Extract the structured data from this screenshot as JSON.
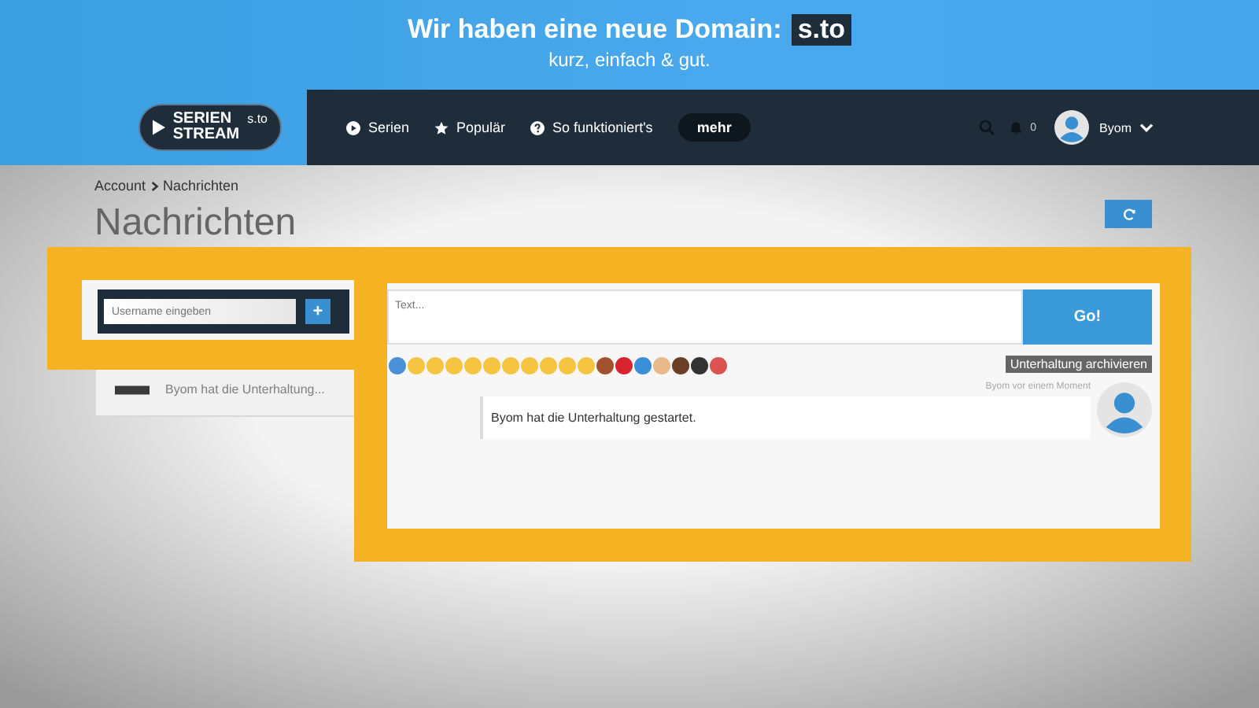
{
  "banner": {
    "headline": "Wir haben eine neue Domain:",
    "domain": "s.to",
    "tagline": "kurz, einfach & gut."
  },
  "logo": {
    "line_1": "SERIEN",
    "line_2": "STREAM",
    "suffix": "s.to"
  },
  "nav": [
    {
      "kind": "play",
      "label": "Serien"
    },
    {
      "kind": "star",
      "label": "Populär"
    },
    {
      "kind": "help",
      "label": "So funktioniert's"
    },
    {
      "kind": "pill",
      "label": "mehr"
    }
  ],
  "user": {
    "notifications": "0",
    "name": "Byom"
  },
  "breadcrumb": [
    "Account",
    "Nachrichten"
  ],
  "heading": "Nachrichten",
  "conversations": [
    {
      "preview": "Byom hat die Unterhaltung..."
    }
  ],
  "new_conversation": {
    "placeholder": "Username eingeben",
    "button": "+"
  },
  "composer": {
    "placeholder": "Text...",
    "button": "Go!"
  },
  "archive_button": "Unterhaltung archivieren",
  "messages": [
    {
      "meta": "Byom vor einem Moment",
      "text": "Byom hat die Unterhaltung gestartet."
    }
  ]
}
